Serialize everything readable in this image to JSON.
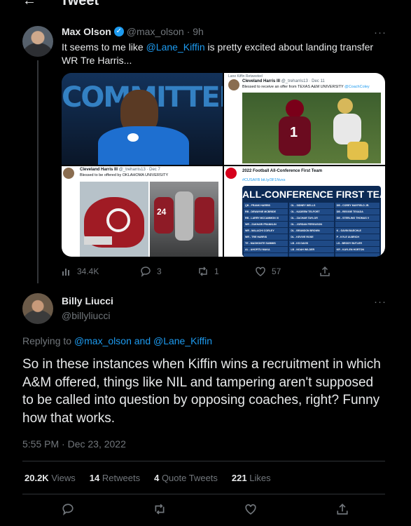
{
  "header": {
    "back_icon": "←",
    "title": "Tweet"
  },
  "parent_tweet": {
    "name": "Max Olson",
    "handle": "@max_olson",
    "time": "· 9h",
    "text_prefix": "It seems to me like ",
    "mention": "@Lane_Kiffin",
    "text_suffix": " is pretty excited about landing transfer WR Tre Harris...",
    "media": {
      "img1_text": "COMMITTED",
      "img2_retweet_label": "Lane Kiffin Retweeted",
      "img2_name": "Cleveland Harris III",
      "img2_handle": "@_treharris13 · Dec 11",
      "img2_text": "Blessed to receive an offer from TEXAS A&M UNIVERSITY",
      "img2_mention": "@CoachColey",
      "img3_name": "Cleveland Harris III",
      "img3_handle": "@_treharris13 · Dec 7",
      "img3_text": "Blessed to be offered by OKLAHOMA UNIVERSITY",
      "img4_header": "2022 Football All-Conference First Team",
      "img4_tags": "#CUSAFB",
      "img4_link": "bit.ly/3F1Nvxs",
      "img4_banner": "ALL-CONFERENCE FIRST TEAM",
      "img4_players": [
        "QB - FRANK HARRIS",
        "OL - SIDNEY WELLS",
        "DB - COREY MAYFIELD JR.",
        "RB - DEWAYNE MCBRIDE",
        "OL - KADEEM TELFORT",
        "DB - REGGIE TEXADA",
        "RB - LARRY MCCAMMON III",
        "OL - ZACHAR TAYLOR",
        "DB - STERLING THOMAS V",
        "WR - ZAKHARI FRANKLIN",
        "OL - JORDAN FERGUSON",
        "",
        "WR - MALACHI CORLEY",
        "DL - BRANDON BROWN",
        "K - GAVIN BAECHLE",
        "WR - TRE HARRIS",
        "DL - KEVIVE ROSE",
        "P - KYLE ULBRICH",
        "TE - MASHONTE SUMMIS",
        "LB - KS DAVIS",
        "LS - BRODY BUTLER",
        "AL - AHOFITU MAKA",
        "LB - NOAH WILDER",
        "KR - KAYLEN HORTON",
        "",
        "",
        ""
      ]
    },
    "stats": {
      "views": "34.4K",
      "replies": "3",
      "retweets": "1",
      "likes": "57"
    }
  },
  "reply_tweet": {
    "name": "Billy Liucci",
    "handle": "@billyliucci",
    "replying_to_label": "Replying to ",
    "replying_to_users": "@max_olson and @Lane_Kiffin",
    "text": "So in these instances when Kiffin wins a recruitment in which A&M offered, things like NIL and tampering aren't supposed to be called into question by opposing coaches, right? Funny how that works.",
    "timestamp": "5:55 PM · Dec 23, 2022",
    "views_num": "20.2K",
    "views_label": "Views",
    "retweets_num": "14",
    "retweets_label": "Retweets",
    "quotes_num": "4",
    "quotes_label": "Quote Tweets",
    "likes_num": "221",
    "likes_label": "Likes"
  },
  "icons": {
    "more": "···",
    "verified": "✓",
    "views": "📊",
    "reply": "reply-icon",
    "retweet": "retweet-icon",
    "like": "heart-icon",
    "share": "share-icon"
  },
  "colors": {
    "accent": "#1d9bf0",
    "text": "#e7e9ea",
    "muted": "#71767b",
    "background": "#000000",
    "divider": "#2f3336"
  }
}
